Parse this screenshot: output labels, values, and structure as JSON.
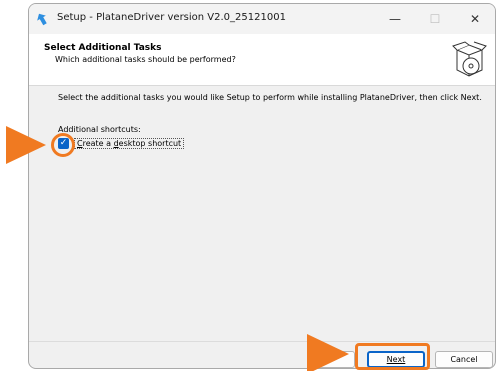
{
  "window": {
    "title": "Setup - PlataneDriver version V2.0_25121001",
    "minimize_glyph": "—",
    "maximize_glyph": "☐",
    "close_glyph": "✕"
  },
  "header": {
    "title": "Select Additional Tasks",
    "subtitle": "Which additional tasks should be performed?",
    "icon": "installer-box-cd-icon"
  },
  "body": {
    "description": "Select the additional tasks you would like Setup to perform while installing PlataneDriver, then click Next.",
    "group_label": "Additional shortcuts:",
    "checkbox": {
      "label_pre": "",
      "label_access": "C",
      "label_mid": "reate a ",
      "label_access2": "d",
      "label_post": "esktop shortcut",
      "checked": true
    }
  },
  "footer": {
    "back_label": "",
    "next_label": "Next",
    "cancel_label": "Cancel"
  },
  "colors": {
    "accent": "#0a64c8",
    "annotation": "#f07a21"
  }
}
